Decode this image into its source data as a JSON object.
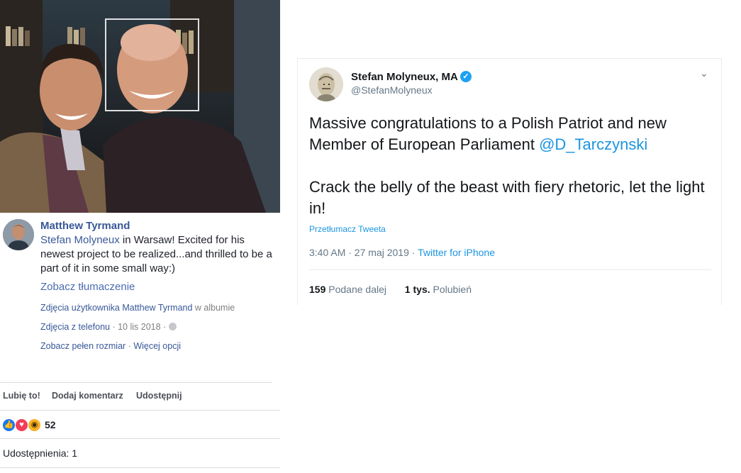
{
  "facebook": {
    "author": "Matthew Tyrmand",
    "post_link_name": "Stefan Molyneux",
    "post_text": " in Warsaw! Excited for his newest project to be realized...and thrilled to be a part of it in some small way:)",
    "translate_link": "Zobacz tłumaczenie",
    "album_prefix": "Zdjęcia użytkownika Matthew Tyrmand",
    "album_suffix": " w albumie",
    "album_name": "Zdjęcia z telefonu",
    "date": " · 10 lis 2018 · ",
    "full_size": "Zobacz pełen rozmiar",
    "more_options": "Więcej opcji",
    "meta_separator": " · ",
    "actions": {
      "like": "Lubię to!",
      "comment": "Dodaj komentarz",
      "share": "Udostępnij"
    },
    "reaction_count": "52",
    "shares": "Udostępnienia: 1",
    "colors": {
      "link": "#385898",
      "like_blue": "#1877f2",
      "love_red": "#f33e58",
      "wow_yellow": "#f7b125"
    }
  },
  "tweet": {
    "display_name": "Stefan Molyneux, MA",
    "handle": "@StefanMolyneux",
    "text_line1": "Massive congratulations to a Polish Patriot and new Member of European Parliament ",
    "mention": "@D_Tarczynski",
    "text_line2": "Crack the belly of the beast with fiery rhetoric, let the light in!",
    "translate": "Przetłumacz Tweeta",
    "timestamp": "3:40 AM · 27 maj 2019 · ",
    "source": "Twitter for iPhone",
    "retweets_count": "159",
    "retweets_label": "Podane dalej",
    "likes_count": "1 tys.",
    "likes_label": "Polubień",
    "colors": {
      "blue": "#1da1f2",
      "link": "#1b95e0"
    }
  }
}
